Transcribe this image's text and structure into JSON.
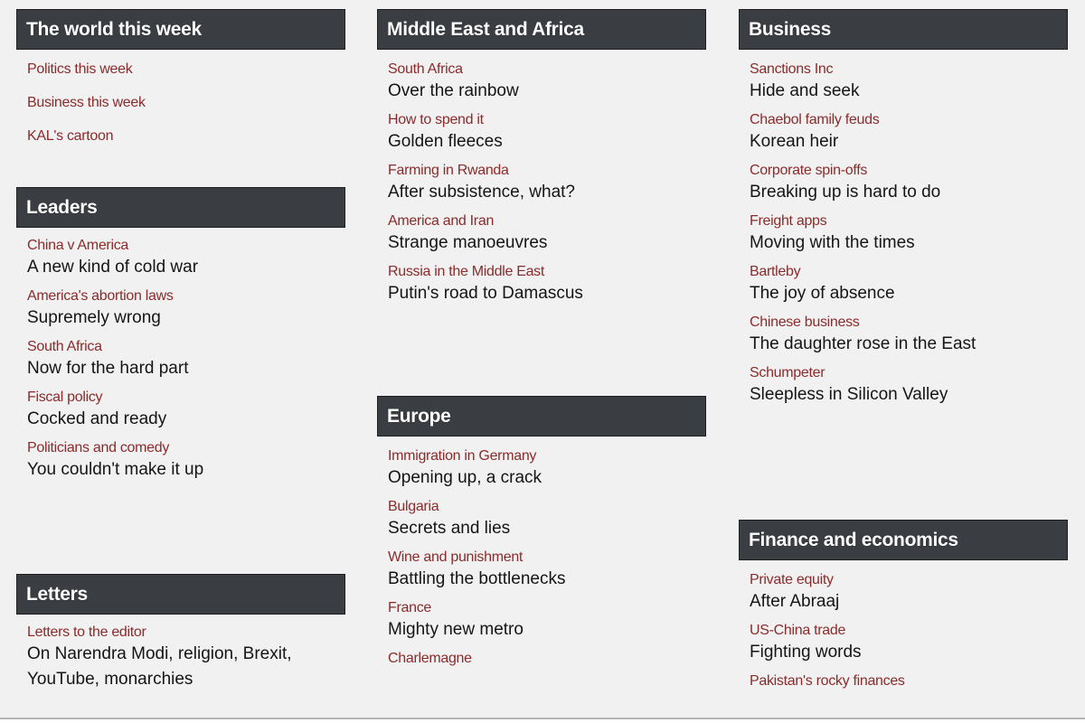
{
  "colors": {
    "header_bg": "#3a3d42",
    "rubric": "#8b2b2b",
    "headline": "#151515",
    "page_bg": "#f1f1f1"
  },
  "columns": [
    {
      "sections": [
        {
          "title": "The world this week",
          "links": [
            "Politics this week",
            "Business this week",
            "KAL's cartoon"
          ]
        },
        {
          "title": "Leaders",
          "items": [
            {
              "rubric": "China v America",
              "headline": "A new kind of cold war"
            },
            {
              "rubric": "America's abortion laws",
              "headline": "Supremely wrong"
            },
            {
              "rubric": "South Africa",
              "headline": "Now for the hard part"
            },
            {
              "rubric": "Fiscal policy",
              "headline": "Cocked and ready"
            },
            {
              "rubric": "Politicians and comedy",
              "headline": "You couldn't make it up"
            }
          ]
        },
        {
          "title": "Letters",
          "items": [
            {
              "rubric": "Letters to the editor",
              "headline": "On Narendra Modi, religion, Brexit, YouTube, monarchies"
            }
          ]
        }
      ]
    },
    {
      "sections": [
        {
          "title": "Middle East and Africa",
          "items": [
            {
              "rubric": "South Africa",
              "headline": "Over the rainbow"
            },
            {
              "rubric": "How to spend it",
              "headline": "Golden fleeces"
            },
            {
              "rubric": "Farming in Rwanda",
              "headline": "After subsistence, what?"
            },
            {
              "rubric": "America and Iran",
              "headline": "Strange manoeuvres"
            },
            {
              "rubric": "Russia in the Middle East",
              "headline": "Putin's road to Damascus"
            }
          ]
        },
        {
          "title": "Europe",
          "items": [
            {
              "rubric": "Immigration in Germany",
              "headline": "Opening up, a crack"
            },
            {
              "rubric": "Bulgaria",
              "headline": "Secrets and lies"
            },
            {
              "rubric": "Wine and punishment",
              "headline": "Battling the bottlenecks"
            },
            {
              "rubric": "France",
              "headline": "Mighty new metro"
            },
            {
              "rubric": "Charlemagne",
              "headline": ""
            }
          ]
        }
      ]
    },
    {
      "sections": [
        {
          "title": "Business",
          "items": [
            {
              "rubric": "Sanctions Inc",
              "headline": "Hide and seek"
            },
            {
              "rubric": "Chaebol family feuds",
              "headline": "Korean heir"
            },
            {
              "rubric": "Corporate spin-offs",
              "headline": "Breaking up is hard to do"
            },
            {
              "rubric": "Freight apps",
              "headline": "Moving with the times"
            },
            {
              "rubric": "Bartleby",
              "headline": "The joy of absence"
            },
            {
              "rubric": "Chinese business",
              "headline": "The daughter rose in the East"
            },
            {
              "rubric": "Schumpeter",
              "headline": "Sleepless in Silicon Valley"
            }
          ]
        },
        {
          "title": "Finance and economics",
          "items": [
            {
              "rubric": "Private equity",
              "headline": "After Abraaj"
            },
            {
              "rubric": "US-China trade",
              "headline": "Fighting words"
            },
            {
              "rubric": "Pakistan's rocky finances",
              "headline": ""
            }
          ]
        }
      ]
    }
  ]
}
